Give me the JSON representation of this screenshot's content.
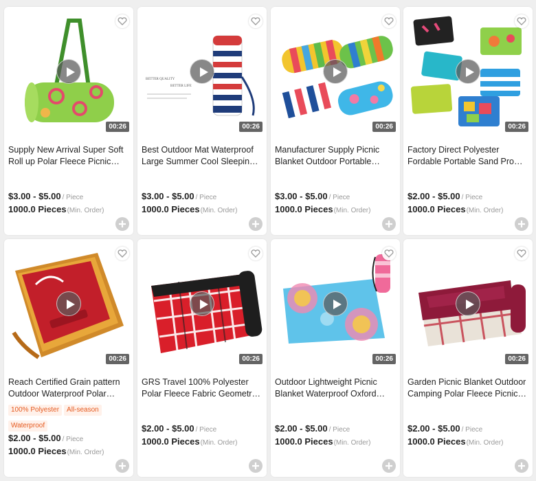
{
  "products": [
    {
      "title": "Supply New Arrival Super Soft Roll up Polar Fleece Picnic Blanket",
      "duration": "00:26",
      "price": "$3.00 - $5.00",
      "price_unit": "/ Piece",
      "moq": "1000.0 Pieces",
      "moq_note": "(Min. Order)",
      "tags": []
    },
    {
      "title": "Best Outdoor Mat Waterproof Large Summer Cool Sleeping Picnic Blanket",
      "duration": "00:26",
      "price": "$3.00 - $5.00",
      "price_unit": "/ Piece",
      "moq": "1000.0 Pieces",
      "moq_note": "(Min. Order)",
      "tags": [],
      "image_text": [
        "BETTER QUALITY",
        "BETTER LIFE"
      ]
    },
    {
      "title": "Manufacturer Supply Picnic Blanket Outdoor Portable Picnic Mat",
      "duration": "00:26",
      "price": "$3.00 - $5.00",
      "price_unit": "/ Piece",
      "moq": "1000.0 Pieces",
      "moq_note": "(Min. Order)",
      "tags": []
    },
    {
      "title": "Factory Direct Polyester Fordable Portable Sand Proof Picnic Mat",
      "duration": "00:26",
      "price": "$2.00 - $5.00",
      "price_unit": "/ Piece",
      "moq": "1000.0 Pieces",
      "moq_note": "(Min. Order)",
      "tags": []
    },
    {
      "title": "Reach Certified Grain pattern Outdoor Waterproof Polar Fleece Blanket",
      "duration": "00:26",
      "price": "$2.00 - $5.00",
      "price_unit": "/ Piece",
      "moq": "1000.0 Pieces",
      "moq_note": "(Min. Order)",
      "tags": [
        "100% Polyester",
        "All-season",
        "Waterproof"
      ]
    },
    {
      "title": "GRS Travel 100% Polyester Polar Fleece Fabric Geometric Picnic Blanket",
      "duration": "00:26",
      "price": "$2.00 - $5.00",
      "price_unit": "/ Piece",
      "moq": "1000.0 Pieces",
      "moq_note": "(Min. Order)",
      "tags": []
    },
    {
      "title": "Outdoor Lightweight Picnic Blanket Waterproof Oxford Picnic Mat",
      "duration": "00:26",
      "price": "$2.00 - $5.00",
      "price_unit": "/ Piece",
      "moq": "1000.0 Pieces",
      "moq_note": "(Min. Order)",
      "tags": []
    },
    {
      "title": "Garden Picnic Blanket Outdoor Camping Polar Fleece Picnic Mat",
      "duration": "00:26",
      "price": "$2.00 - $5.00",
      "price_unit": "/ Piece",
      "moq": "1000.0 Pieces",
      "moq_note": "(Min. Order)",
      "tags": []
    }
  ],
  "icons": {
    "play": "play-icon",
    "favorite": "heart-icon",
    "add": "plus-icon"
  },
  "colors": {
    "tag_text": "#e5591e",
    "tag_bg": "#fff1ea",
    "price_text": "#222222"
  }
}
